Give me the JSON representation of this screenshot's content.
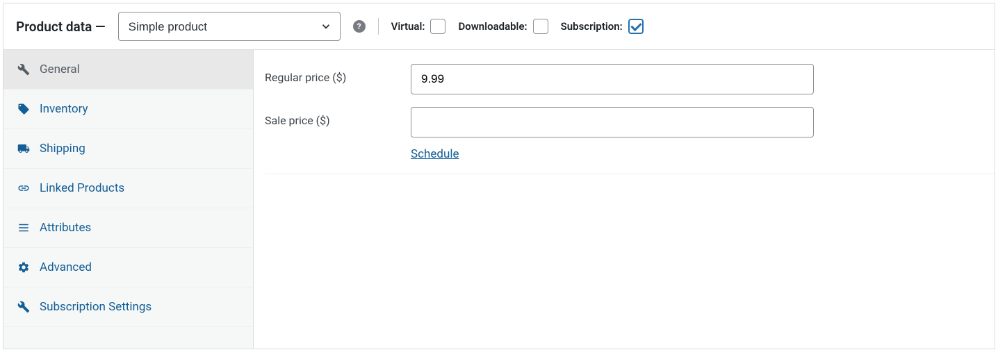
{
  "header": {
    "title": "Product data —",
    "product_type": "Simple product",
    "checkboxes": {
      "virtual_label": "Virtual:",
      "virtual_checked": false,
      "downloadable_label": "Downloadable:",
      "downloadable_checked": false,
      "subscription_label": "Subscription:",
      "subscription_checked": true
    }
  },
  "tabs": [
    {
      "label": "General",
      "active": true
    },
    {
      "label": "Inventory",
      "active": false
    },
    {
      "label": "Shipping",
      "active": false
    },
    {
      "label": "Linked Products",
      "active": false
    },
    {
      "label": "Attributes",
      "active": false
    },
    {
      "label": "Advanced",
      "active": false
    },
    {
      "label": "Subscription Settings",
      "active": false
    }
  ],
  "general": {
    "regular_price_label": "Regular price ($)",
    "regular_price_value": "9.99",
    "sale_price_label": "Sale price ($)",
    "sale_price_value": "",
    "schedule_label": "Schedule"
  }
}
